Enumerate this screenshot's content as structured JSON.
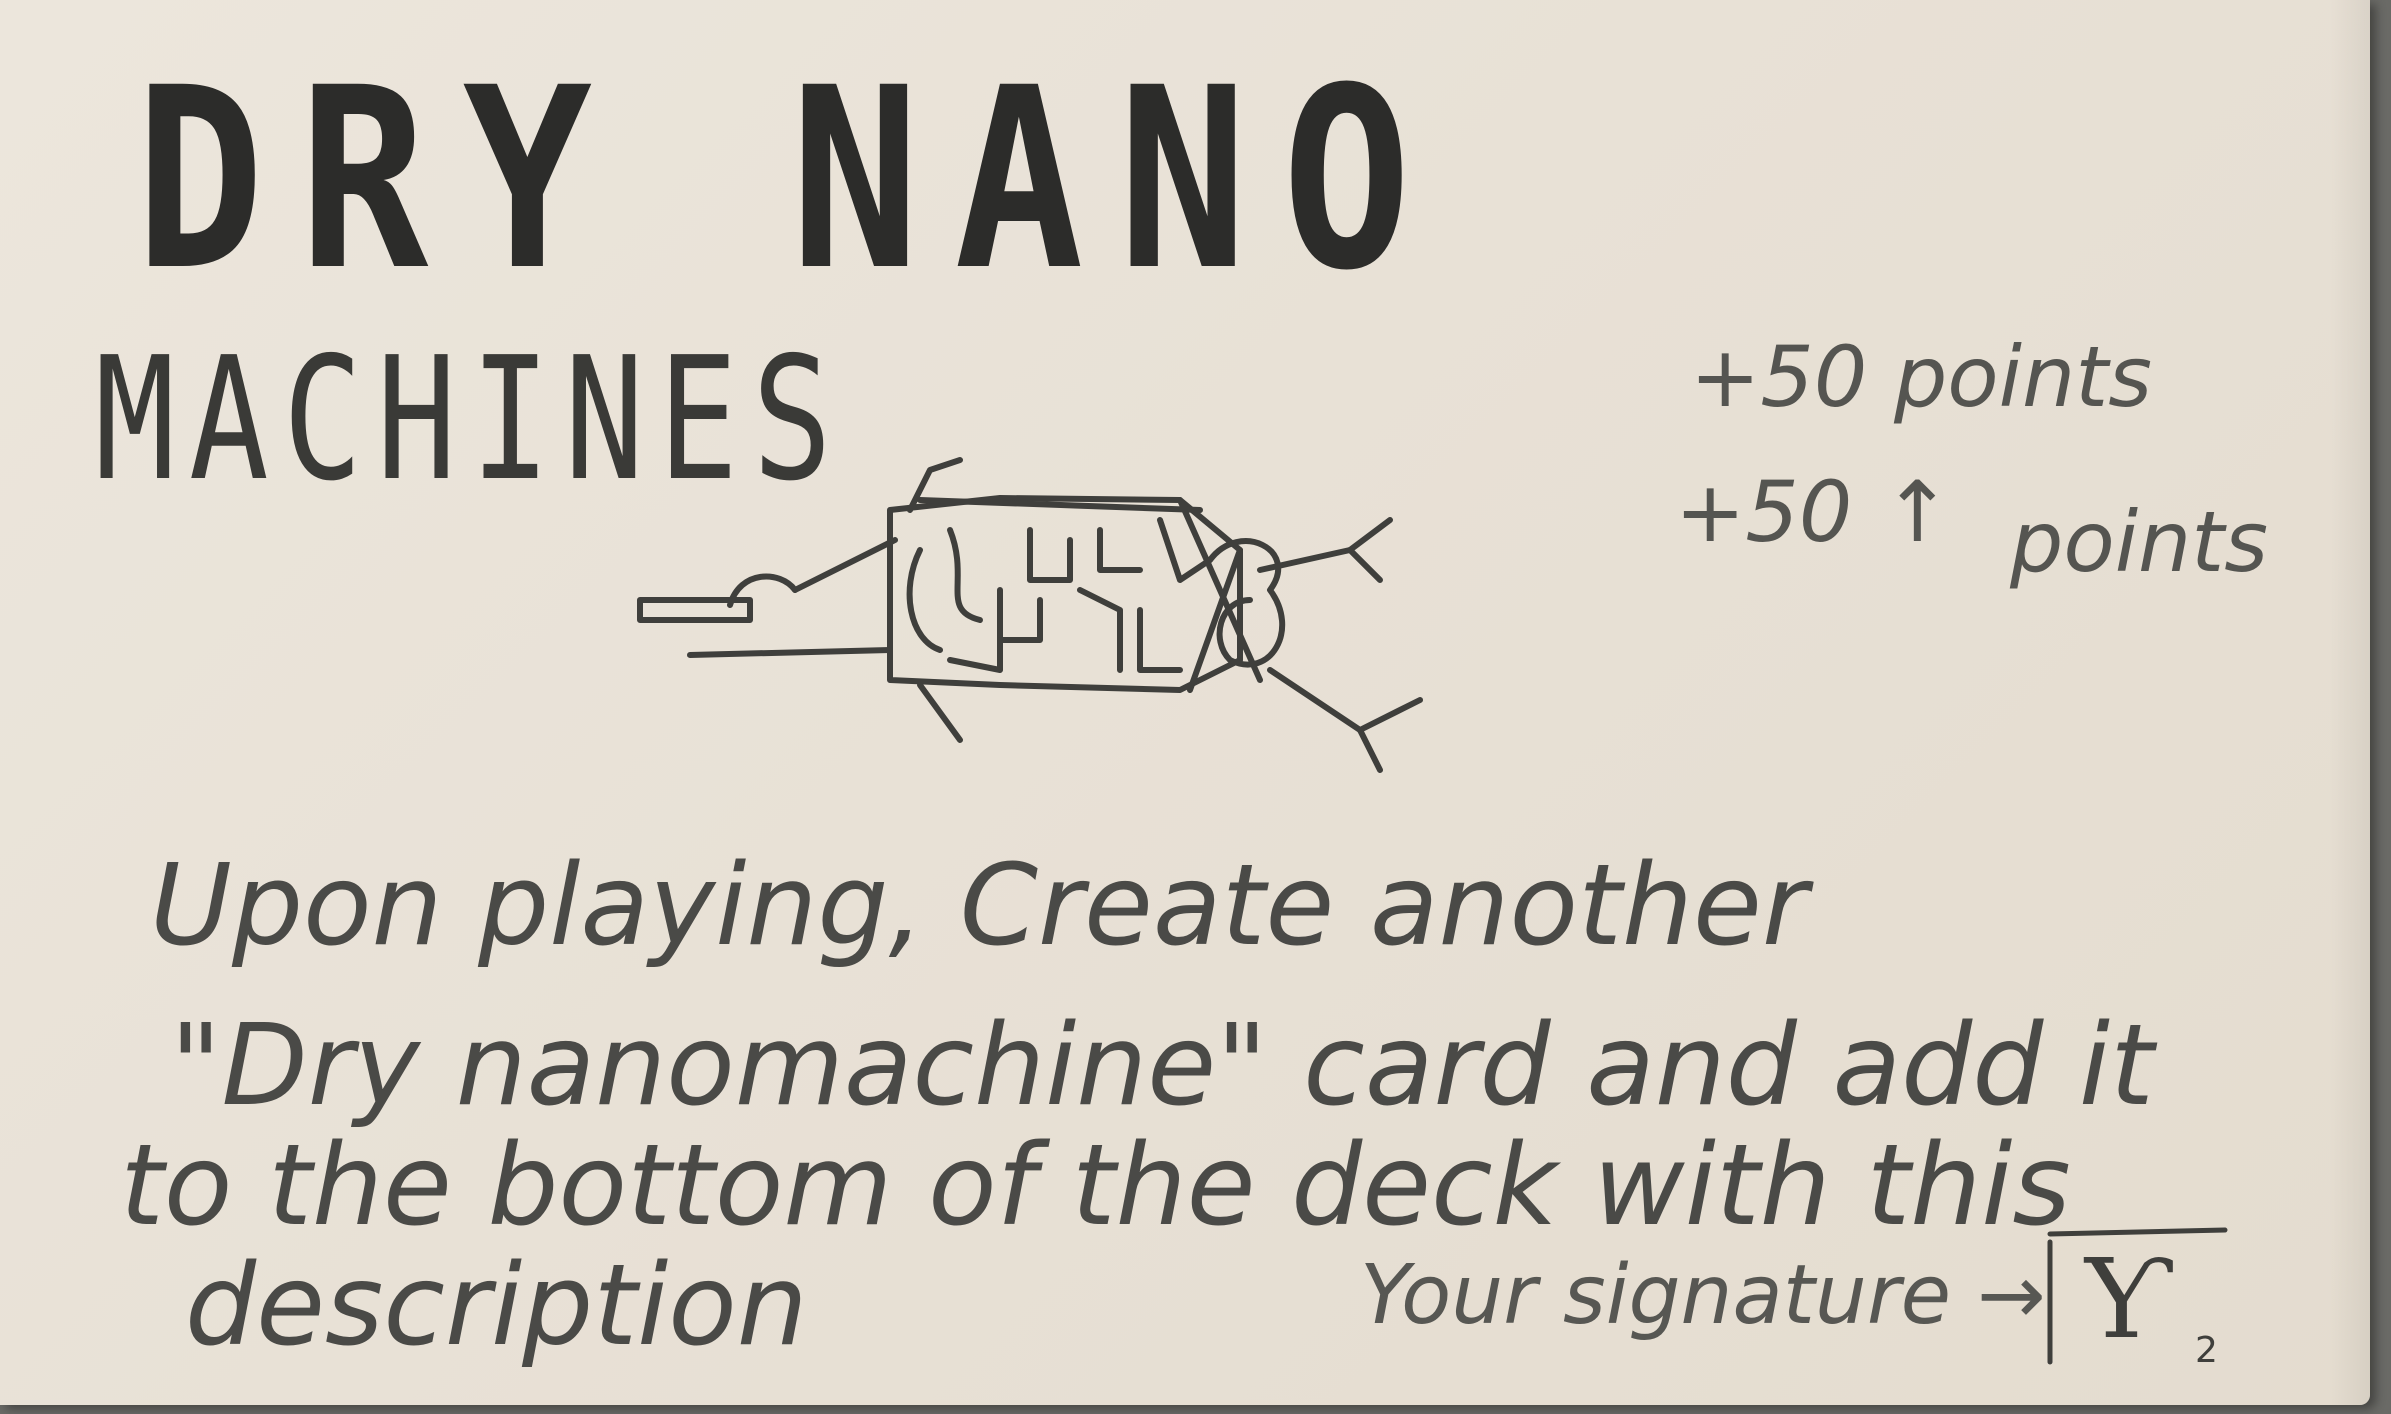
{
  "card": {
    "title_line1": "DRY NANO",
    "title_line2": "MACHINES",
    "points_line1": "+50 points",
    "points_line2_prefix": "+50",
    "points_line2_arrow": "↑",
    "points_line2_suffix": "points",
    "description_line1": "Upon playing, Create another",
    "description_line2": "\"Dry nanomachine\" card and add it",
    "description_line3": "to the bottom of the deck with this",
    "description_line4": "description",
    "signature_label": "Your signature →",
    "signature_mark": "Ƴ",
    "signature_subscript": "2"
  },
  "colors": {
    "card_paper": "#e9e2d7",
    "background": "#6a6a66",
    "pencil_dark": "#2c2c2a",
    "pencil_light": "#4b4b48"
  },
  "icons": {
    "illustration": "nanomachine-drawing-icon"
  }
}
